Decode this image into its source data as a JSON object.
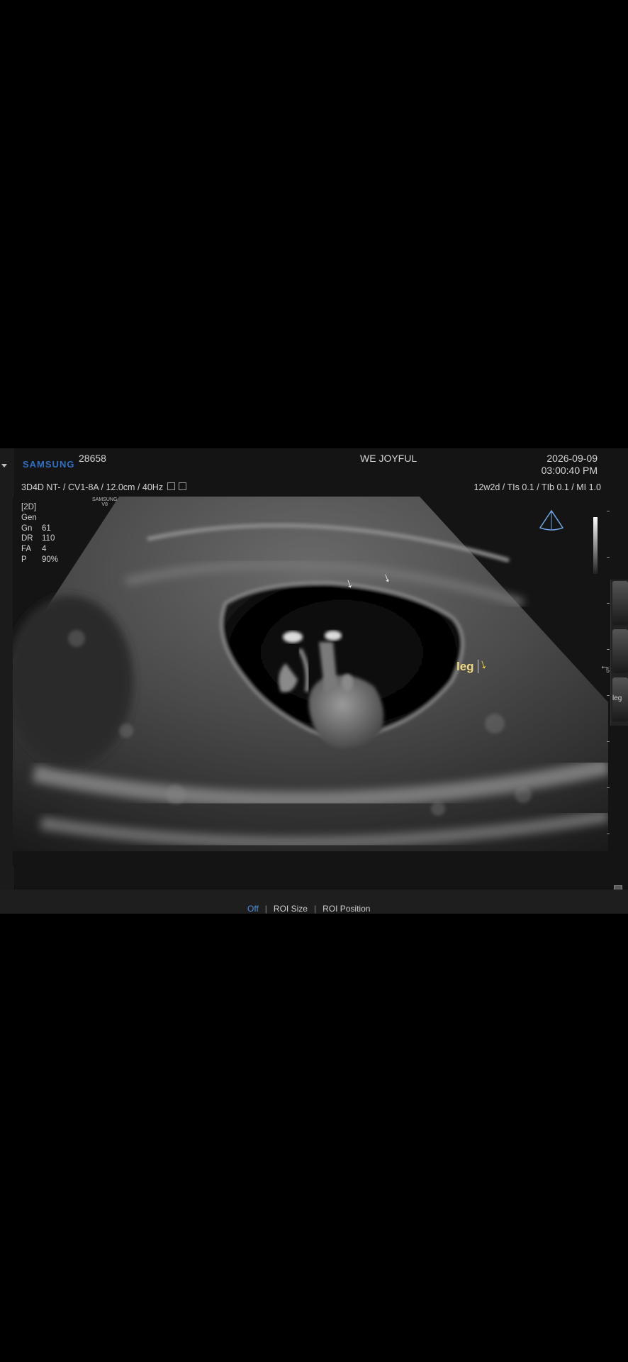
{
  "header": {
    "brand": "SAMSUNG",
    "patient_id": "28658",
    "hospital": "WE JOYFUL",
    "date": "2026-09-09",
    "time": "03:00:40 PM"
  },
  "probe_line": {
    "text": "3D4D NT- / CV1-8A / 12.0cm / 40Hz",
    "safety": "12w2d / TIs  0.1 / TIb  0.1 / MI   1.0"
  },
  "vendor_mark": {
    "line1": "SAMSUNG",
    "line2": "V8"
  },
  "params": [
    {
      "k": "[2D]",
      "v": ""
    },
    {
      "k": "Gen",
      "v": ""
    },
    {
      "k": "Gn",
      "v": "61"
    },
    {
      "k": "DR",
      "v": "110"
    },
    {
      "k": "FA",
      "v": "4"
    },
    {
      "k": "P",
      "v": "90%"
    }
  ],
  "annotation": {
    "label": "leg"
  },
  "thumbnail_label": "leg",
  "side_depth_label": "5",
  "bottom_menu": {
    "off": "Off",
    "roi_size": "ROI Size",
    "roi_position": "ROI Position"
  },
  "colors": {
    "brand": "#2f6fc2",
    "menu_active": "#4f8fdc",
    "annotation_text": "#f0d880",
    "annotation_arrow": "#f2e032"
  }
}
